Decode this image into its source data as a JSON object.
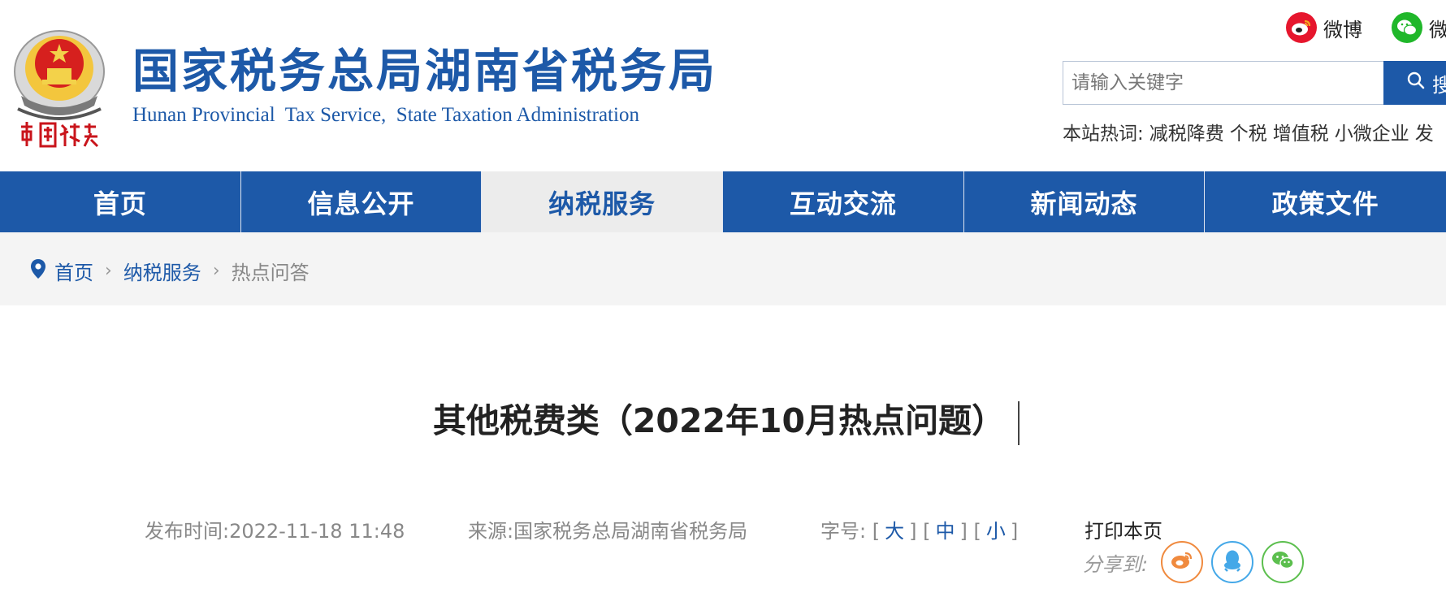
{
  "header": {
    "site_title": "国家税务总局湖南省税务局",
    "site_subtitle": "Hunan Provincial  Tax Service,  State Taxation Administration",
    "emblem_text": "中国税务",
    "social": [
      {
        "label": "微博",
        "icon": "weibo-icon",
        "color": "#e6162d"
      },
      {
        "label": "微",
        "icon": "wechat-icon",
        "color": "#20b72a"
      }
    ],
    "search": {
      "placeholder": "请输入关键字",
      "button_label": "搜"
    },
    "hotwords": {
      "label": "本站热词:",
      "items": [
        "减税降费",
        "个税",
        "增值税",
        "小微企业",
        "发"
      ]
    }
  },
  "nav": {
    "items": [
      {
        "label": "首页"
      },
      {
        "label": "信息公开"
      },
      {
        "label": "纳税服务",
        "active": true
      },
      {
        "label": "互动交流"
      },
      {
        "label": "新闻动态"
      },
      {
        "label": "政策文件"
      }
    ]
  },
  "breadcrumb": {
    "icon": "location-pin-icon",
    "items": [
      "首页",
      "纳税服务",
      "热点问答"
    ]
  },
  "article": {
    "title": "其他税费类（2022年10月热点问题）",
    "publish": {
      "label": "发布时间:",
      "value": "2022-11-18 11:48"
    },
    "source": {
      "label": "来源:",
      "value": "国家税务总局湖南省税务局"
    },
    "font_size": {
      "label": "字号:",
      "large": "大",
      "medium": "中",
      "small": "小"
    },
    "print_label": "打印本页",
    "share": {
      "label": "分享到:",
      "targets": [
        "weibo-icon",
        "qq-icon",
        "wechat-icon"
      ]
    }
  },
  "colors": {
    "brand_blue": "#1d59a8",
    "nav_active_bg": "#ececec",
    "breadcrumb_bg": "#f4f4f4"
  }
}
